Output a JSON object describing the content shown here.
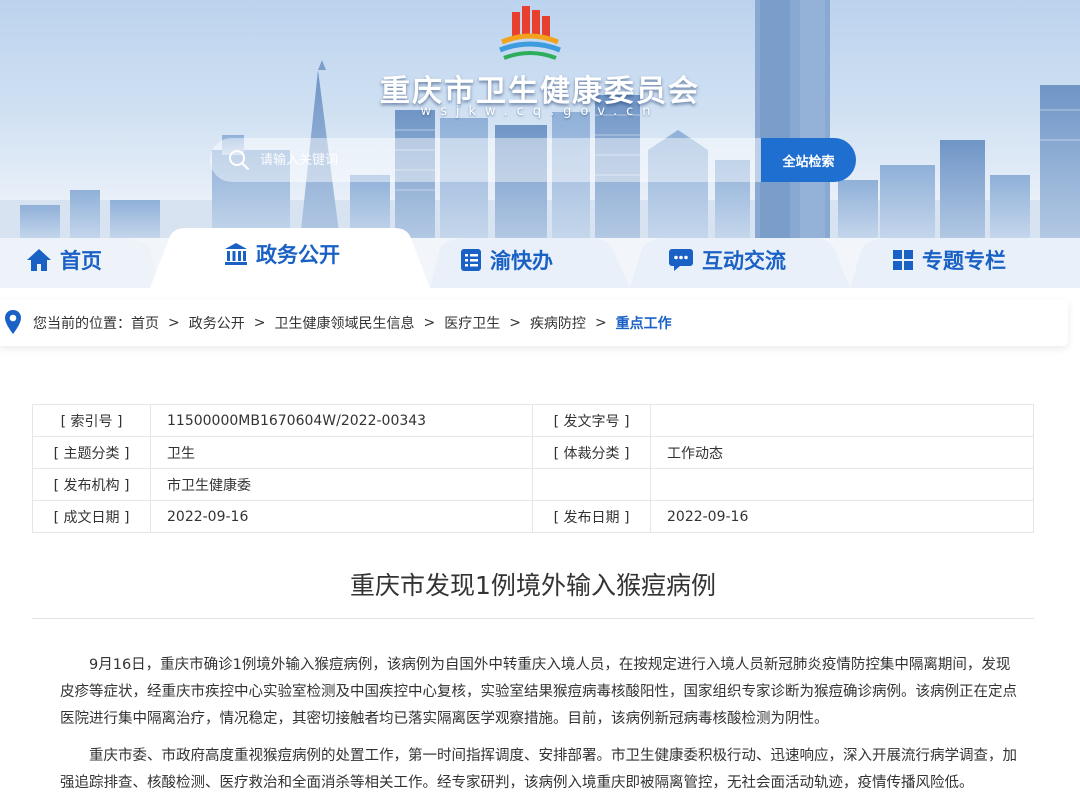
{
  "header": {
    "site_title": "重庆市卫生健康委员会",
    "site_domain": "wsjkw.cq.gov.cn",
    "search_placeholder": "请输入关键词",
    "search_button": "全站检索"
  },
  "nav": {
    "items": [
      {
        "label": "首页",
        "icon": "home-icon"
      },
      {
        "label": "政务公开",
        "icon": "government-building-icon"
      },
      {
        "label": "渝快办",
        "icon": "document-list-icon"
      },
      {
        "label": "互动交流",
        "icon": "chat-bubble-icon"
      },
      {
        "label": "专题专栏",
        "icon": "grid-icon"
      }
    ],
    "active": "政务公开"
  },
  "breadcrumb": {
    "prefix": "您当前的位置：",
    "items": [
      "首页",
      "政务公开",
      "卫生健康领域民生信息",
      "医疗卫生",
      "疾病防控"
    ],
    "current": "重点工作",
    "separator": ">"
  },
  "meta": {
    "index_label": "[ 索引号 ]",
    "index_value": "11500000MB1670604W/2022-00343",
    "doc_no_label": "[ 发文字号 ]",
    "doc_no_value": "",
    "topic_label": "[ 主题分类 ]",
    "topic_value": "卫生",
    "genre_label": "[ 体裁分类 ]",
    "genre_value": "工作动态",
    "issuer_label": "[ 发布机构 ]",
    "issuer_value": "市卫生健康委",
    "created_label": "[ 成文日期 ]",
    "created_value": "2022-09-16",
    "published_label": "[ 发布日期 ]",
    "published_value": "2022-09-16"
  },
  "article": {
    "title": "重庆市发现1例境外输入猴痘病例",
    "paragraphs": [
      "9月16日，重庆市确诊1例境外输入猴痘病例，该病例为自国外中转重庆入境人员，在按规定进行入境人员新冠肺炎疫情防控集中隔离期间，发现皮疹等症状，经重庆市疾控中心实验室检测及中国疾控中心复核，实验室结果猴痘病毒核酸阳性，国家组织专家诊断为猴痘确诊病例。该病例正在定点医院进行集中隔离治疗，情况稳定，其密切接触者均已落实隔离医学观察措施。目前，该病例新冠病毒核酸检测为阴性。",
      "重庆市委、市政府高度重视猴痘病例的处置工作，第一时间指挥调度、安排部署。市卫生健康委积极行动、迅速响应，深入开展流行病学调查，加强追踪排查、核酸检测、医疗救治和全面消杀等相关工作。经专家研判，该病例入境重庆即被隔离管控，无社会面活动轨迹，疫情传播风险低。"
    ]
  },
  "colors": {
    "brand_blue": "#1a61c5",
    "search_button": "#1f6fd1"
  }
}
